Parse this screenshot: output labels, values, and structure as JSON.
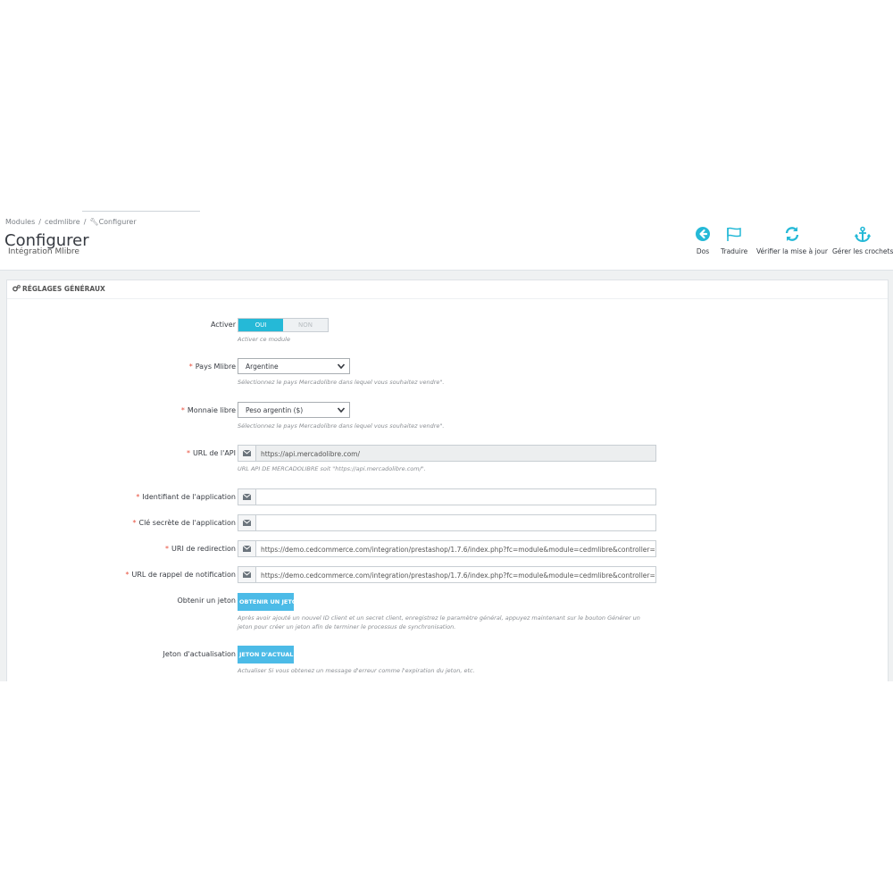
{
  "breadcrumb": [
    "Modules",
    "cedmlibre",
    "Configurer"
  ],
  "breadcrumb_sep": "/",
  "page": {
    "title": "Configurer",
    "subtitle": "Intégration Mlibre"
  },
  "toolbar": {
    "back": "Dos",
    "translate": "Traduire",
    "check_update": "Vérifier la mise à jour",
    "manage_hooks": "Gérer les crochets"
  },
  "panel": {
    "title": "RÉGLAGES GÉNÉRAUX",
    "activer": {
      "label": "Activer",
      "on": "OUI",
      "off": "NON",
      "selected": "OUI",
      "help": "Activer ce module"
    },
    "pays": {
      "label": "Pays Mlibre",
      "value": "Argentine",
      "help": "Sélectionnez le pays Mercadolibre dans lequel vous souhaitez vendre\"."
    },
    "monnaie": {
      "label": "Monnaie libre",
      "value": "Peso argentin ($)",
      "help": "Sélectionnez le pays Mercadolibre dans lequel vous souhaitez vendre\"."
    },
    "api_url": {
      "label": "URL de l'API",
      "value": "https://api.mercadolibre.com/",
      "help": "URL API DE MERCADOLIBRE soit \"https://api.mercadolibre.com/\"."
    },
    "app_id": {
      "label": "Identifiant de l'application",
      "value": ""
    },
    "app_secret": {
      "label": "Clé secrète de l'application",
      "value": ""
    },
    "redirect_uri": {
      "label": "URI de redirection",
      "value": "https://demo.cedcommerce.com/integration/prestashop/1.7.6/index.php?fc=module&module=cedmlibre&controller=authorize"
    },
    "notif_url": {
      "label": "URL de rappel de notification",
      "value": "https://demo.cedcommerce.com/integration/prestashop/1.7.6/index.php?fc=module&module=cedmlibre&controller=notification"
    },
    "get_token": {
      "label": "Obtenir un jeton",
      "button": "OBTENIR UN JETON",
      "help_line1": "Après avoir ajouté un nouvel ID client et un secret client, enregistrez le paramètre général, appuyez maintenant sur le bouton Générer un",
      "help_line2": "jeton pour créer un jeton afin de terminer le processus de synchronisation."
    },
    "refresh_token": {
      "label": "Jeton d'actualisation",
      "button": "JETON D'ACTUALISATION",
      "help": "Actualiser Si vous obtenez un message d'erreur comme l'expiration du jeton, etc."
    }
  },
  "colors": {
    "accent": "#25b9d7",
    "button": "#4cbbe7",
    "required": "#e84e3c"
  },
  "icons": [
    "arrow-circle-left-icon",
    "flag-icon",
    "refresh-icon",
    "anchor-icon",
    "gears-icon",
    "envelope-icon",
    "chevron-down-icon"
  ]
}
